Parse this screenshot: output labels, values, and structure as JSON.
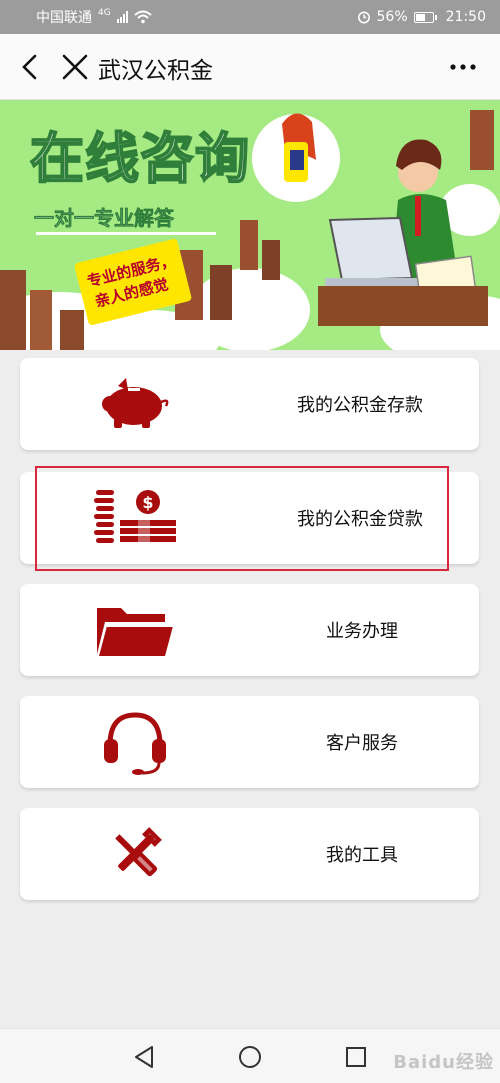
{
  "status_bar": {
    "carrier": "中国联通",
    "network": "4G",
    "battery": "56%",
    "time": "21:50"
  },
  "title_bar": {
    "title": "武汉公积金"
  },
  "banner": {
    "headline": "在线咨询",
    "subline": "一对一专业解答",
    "tag_line1": "专业的服务，",
    "tag_line2": "亲人的感觉"
  },
  "menu": [
    {
      "label": "我的公积金存款",
      "icon": "piggy-bank-icon"
    },
    {
      "label": "我的公积金贷款",
      "icon": "coins-money-icon"
    },
    {
      "label": "业务办理",
      "icon": "folder-icon"
    },
    {
      "label": "客户服务",
      "icon": "headset-icon"
    },
    {
      "label": "我的工具",
      "icon": "tools-icon"
    }
  ],
  "colors": {
    "icon_red": "#a80c0c",
    "highlight": "#d7263d",
    "banner_green": "#a6ea84"
  },
  "watermark": "Baidu经验"
}
